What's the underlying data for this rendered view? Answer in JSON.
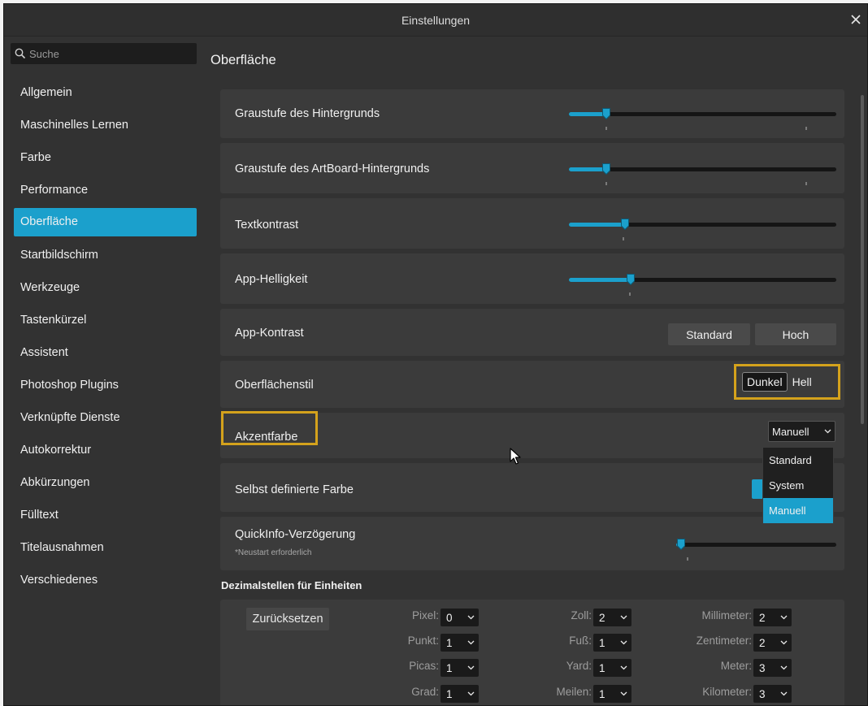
{
  "window": {
    "title": "Einstellungen"
  },
  "search": {
    "placeholder": "Suche"
  },
  "sidebar": {
    "items": [
      {
        "label": "Allgemein"
      },
      {
        "label": "Maschinelles Lernen"
      },
      {
        "label": "Farbe"
      },
      {
        "label": "Performance"
      },
      {
        "label": "Oberfläche",
        "active": true
      },
      {
        "label": "Startbildschirm"
      },
      {
        "label": "Werkzeuge"
      },
      {
        "label": "Tastenkürzel"
      },
      {
        "label": "Assistent"
      },
      {
        "label": "Photoshop Plugins"
      },
      {
        "label": "Verknüpfte Dienste"
      },
      {
        "label": "Autokorrektur"
      },
      {
        "label": "Abkürzungen"
      },
      {
        "label": "Fülltext"
      },
      {
        "label": "Titelausnahmen"
      },
      {
        "label": "Verschiedenes"
      }
    ]
  },
  "main": {
    "section_title": "Oberfläche",
    "background_gray": {
      "label": "Graustufe des Hintergrunds",
      "value": 0.14
    },
    "artboard_gray": {
      "label": "Graustufe des ArtBoard-Hintergrunds",
      "value": 0.14
    },
    "text_contrast": {
      "label": "Textkontrast",
      "value": 0.21
    },
    "app_brightness": {
      "label": "App-Helligkeit",
      "value": 0.23
    },
    "app_contrast": {
      "label": "App-Kontrast",
      "options": [
        "Standard",
        "Hoch"
      ]
    },
    "ui_style": {
      "label": "Oberflächenstil",
      "options": [
        "Dunkel",
        "Hell"
      ],
      "selected": "Dunkel"
    },
    "accent_color": {
      "label": "Akzentfarbe",
      "value": "Manuell",
      "options": [
        "Standard",
        "System",
        "Manuell"
      ],
      "selected": "Manuell"
    },
    "custom_color": {
      "label": "Selbst definierte Farbe",
      "color": "#1ba0cc"
    },
    "tooltip_delay": {
      "label": "QuickInfo-Verzögerung",
      "note": "*Neustart erforderlich",
      "value": 0.03
    },
    "units": {
      "title": "Dezimalstellen für Einheiten",
      "reset_label": "Zurücksetzen",
      "items": [
        {
          "label": "Pixel:",
          "value": "0"
        },
        {
          "label": "Zoll:",
          "value": "2"
        },
        {
          "label": "Millimeter:",
          "value": "2"
        },
        {
          "label": "Punkt:",
          "value": "1"
        },
        {
          "label": "Fuß:",
          "value": "1"
        },
        {
          "label": "Zentimeter:",
          "value": "2"
        },
        {
          "label": "Picas:",
          "value": "1"
        },
        {
          "label": "Yard:",
          "value": "1"
        },
        {
          "label": "Meter:",
          "value": "3"
        },
        {
          "label": "Grad:",
          "value": "1"
        },
        {
          "label": "Meilen:",
          "value": "1"
        },
        {
          "label": "Kilometer:",
          "value": "3"
        }
      ]
    }
  },
  "colors": {
    "accent": "#1ba0cc",
    "highlight": "#d4a21c",
    "background": "#323232",
    "panel": "#3b3b3b"
  },
  "icons": [
    "close-icon",
    "search-icon",
    "chevron-down-icon",
    "mouse-cursor-icon"
  ]
}
